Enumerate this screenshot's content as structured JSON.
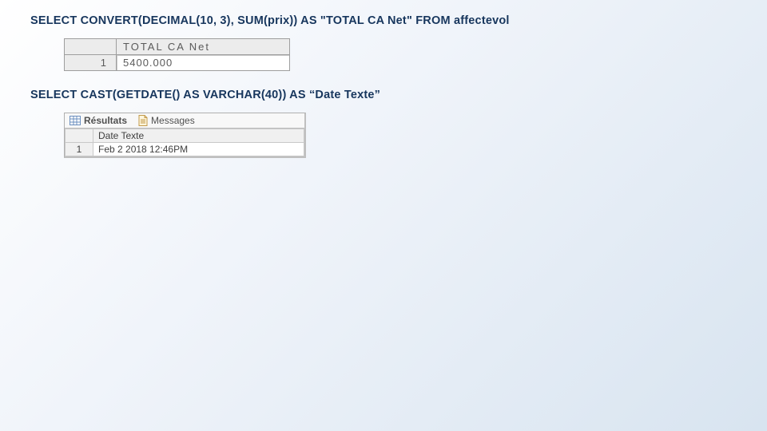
{
  "query1": {
    "sql": "SELECT CONVERT(DECIMAL(10, 3), SUM(prix)) AS \"TOTAL CA Net\" FROM affectevol",
    "column_header": "TOTAL CA Net",
    "row_number": "1",
    "value": "5400.000"
  },
  "query2": {
    "sql": "SELECT CAST(GETDATE() AS VARCHAR(40)) AS “Date Texte”",
    "tabs": {
      "results": "Résultats",
      "messages": "Messages"
    },
    "column_header": "Date Texte",
    "row_number": "1",
    "value": "Feb  2 2018 12:46PM"
  }
}
